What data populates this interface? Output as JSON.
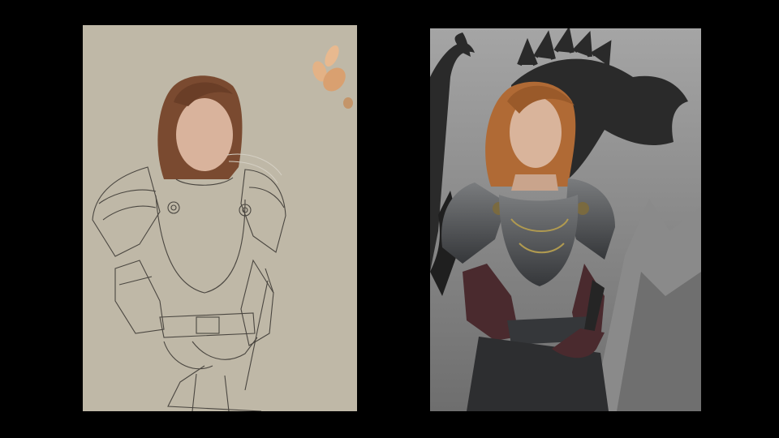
{
  "scene": {
    "background_color": "#000000",
    "panels": [
      {
        "id": "sketch",
        "kind": "work-in-progress sketch",
        "canvas_color": "#bfb8a7",
        "line_color": "#4a4640",
        "skin_color": "#d9b39c",
        "hair_color": "#7a4a30",
        "swatches": [
          "#e8b98f",
          "#e3b286",
          "#d9a070",
          "#c4956a"
        ]
      },
      {
        "id": "final",
        "kind": "finished painting",
        "sky_color": "#9a9a9a",
        "dragon_color": "#2a2a2a",
        "armor_color": "#5f6163",
        "leather_color": "#4a2a2e",
        "hair_color": "#b06a35",
        "skin_color": "#d9b49b"
      }
    ]
  }
}
